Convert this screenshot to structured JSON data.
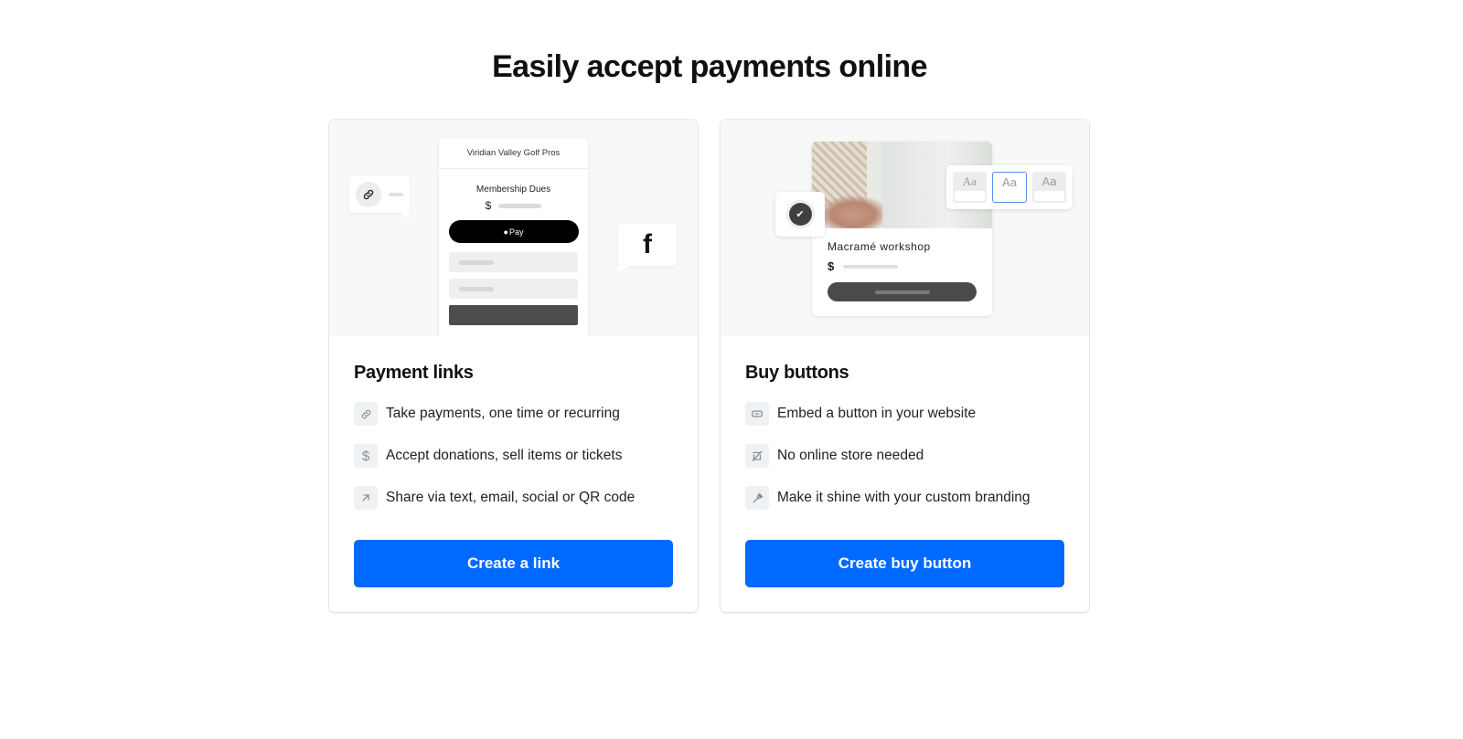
{
  "page": {
    "title": "Easily accept payments online"
  },
  "cards": [
    {
      "title": "Payment links",
      "illustration": {
        "merchant_name": "Viridian Valley Golf Pros",
        "item_name": "Membership Dues",
        "currency_symbol": "$",
        "pay_button_label": "Pay",
        "social_icon": "facebook-icon",
        "social_glyph": "f",
        "link_icon": "link-icon"
      },
      "features": [
        {
          "icon": "link-icon",
          "text": "Take payments, one time or recurring"
        },
        {
          "icon": "dollar-icon",
          "glyph": "$",
          "text": "Accept donations, sell items or tickets"
        },
        {
          "icon": "arrow-up-right-icon",
          "glyph": "↗",
          "text": "Share via text, email, social or QR code"
        }
      ],
      "cta_label": "Create a link"
    },
    {
      "title": "Buy buttons",
      "illustration": {
        "product_name": "Macramé workshop",
        "currency_symbol": "$",
        "check_glyph": "✔",
        "font_options": [
          "Aa",
          "Aa",
          "Aa"
        ],
        "selected_font_index": 1
      },
      "features": [
        {
          "icon": "embed-button-icon",
          "text": "Embed a button in your website"
        },
        {
          "icon": "no-store-icon",
          "text": "No online store needed"
        },
        {
          "icon": "eyedropper-icon",
          "text": "Make it shine with your custom branding"
        }
      ],
      "cta_label": "Create buy button"
    }
  ],
  "colors": {
    "primary": "#006aff",
    "title_text": "#101010",
    "hero_background": "#f7f8f8",
    "icon_tile": "#f0f1f2",
    "selected_outline": "#5b8def"
  }
}
